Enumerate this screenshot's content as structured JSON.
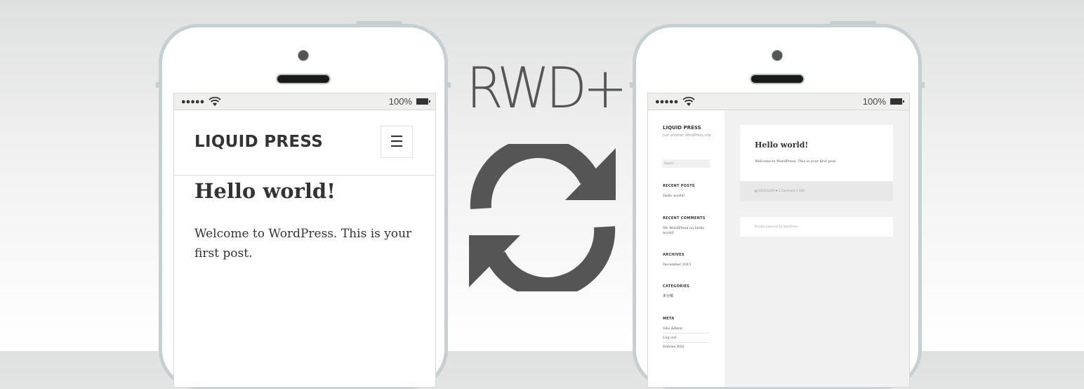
{
  "status_bar": {
    "signal_dots": "●●●●●",
    "battery_percent": "100%"
  },
  "mobile_site": {
    "site_title": "LIQUID PRESS",
    "menu_icon": "☰",
    "post_title": "Hello world!",
    "post_body": "Welcome to WordPress. This is your first post."
  },
  "center": {
    "logo_text": "RWD+",
    "icon": "refresh-icon",
    "icon_color": "#555555"
  },
  "desktop_site": {
    "site_title": "LIQUID PRESS",
    "site_description": "Just another WordPress site",
    "search_placeholder": "Search …",
    "widgets": {
      "recent_posts": {
        "title": "RECENT POSTS",
        "items": [
          "Hello world!"
        ]
      },
      "recent_comments": {
        "title": "RECENT COMMENTS",
        "items": [
          "Mr WordPress on Hello world!"
        ]
      },
      "archives": {
        "title": "ARCHIVES",
        "items": [
          "December 2015"
        ]
      },
      "categories": {
        "title": "CATEGORIES",
        "items": [
          "未分類"
        ]
      },
      "meta": {
        "title": "META",
        "items": [
          "Site Admin",
          "Log out",
          "Entries RSS"
        ]
      }
    },
    "post": {
      "title": "Hello world!",
      "body": "Welcome to WordPress. This is your first post.",
      "meta": "▦ 2015/12/09  ❤ 1 Comment  ✎ Edit"
    },
    "footer": "Proudly powered by WordPress"
  },
  "colors": {
    "phone_frame": "#c6d0d2",
    "text_dark": "#333333",
    "main_bg": "#f1f1f1"
  }
}
